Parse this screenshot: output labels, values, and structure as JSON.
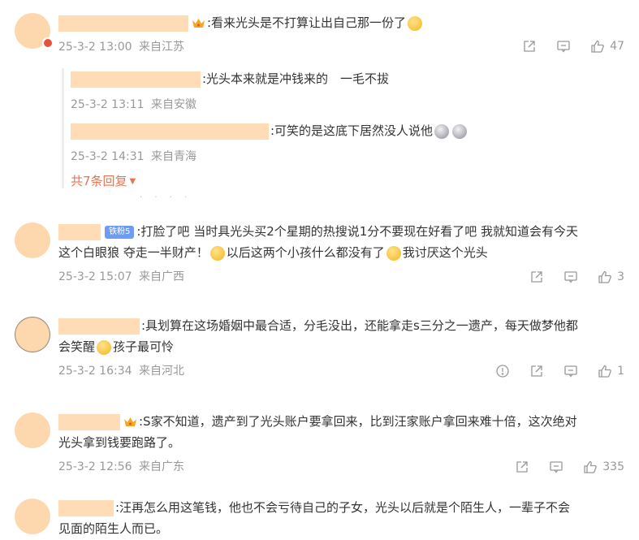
{
  "comments": [
    {
      "text": ":看来光头是不打算让出自己那一份了",
      "time": "25-3-2 13:00",
      "location": "来自江苏",
      "likes": "47",
      "replies": [
        {
          "text": ":光头本来就是冲钱来的　一毛不拔",
          "time": "25-3-2 13:11",
          "location": "来自安徽"
        },
        {
          "text": ":可笑的是这底下居然没人说他",
          "time": "25-3-2 14:31",
          "location": "来自青海"
        }
      ],
      "more_replies": "共7条回复"
    },
    {
      "badge": "铁粉5",
      "text_line1": ":打脸了吧 当时具光头买2个星期的热搜说1分不要现在好看了吧 我就知道会有今天",
      "text_line2a": "这个白眼狼 夺走一半财产！",
      "text_line2b": "以后这两个小孩什么都没有了",
      "text_line2c": "我讨厌这个光头",
      "time": "25-3-2 15:07",
      "location": "来自广西",
      "likes": "3"
    },
    {
      "text_line1": ":具划算在这场婚姻中最合适，分毛没出，还能拿走s三分之一遗产，每天做梦他都",
      "text_line2a": "会笑醒",
      "text_line2b": "孩子最可怜",
      "time": "25-3-2 16:34",
      "location": "来自河北",
      "likes": "1"
    },
    {
      "text_line1": ":S家不知道，遗产到了光头账户要拿回来，比到汪家账户拿回来难十倍，这次绝对",
      "text_line2": "光头拿到钱要跑路了。",
      "time": "25-3-2 12:56",
      "location": "来自广东",
      "likes": "335"
    },
    {
      "text_line1": ":汪再怎么用这笔钱，他也不会亏待自己的子女，光头以后就是个陌生人，一辈子不会",
      "text_line2": "见面的陌生人而已。"
    }
  ],
  "icons": {
    "share": "share-icon",
    "comment": "comment-icon",
    "like": "like-icon",
    "report": "report-icon"
  },
  "colors": {
    "accent": "#eb7350",
    "meta": "#999999",
    "redaction": "#fddcb6",
    "avatar": "#fdd7ad"
  }
}
